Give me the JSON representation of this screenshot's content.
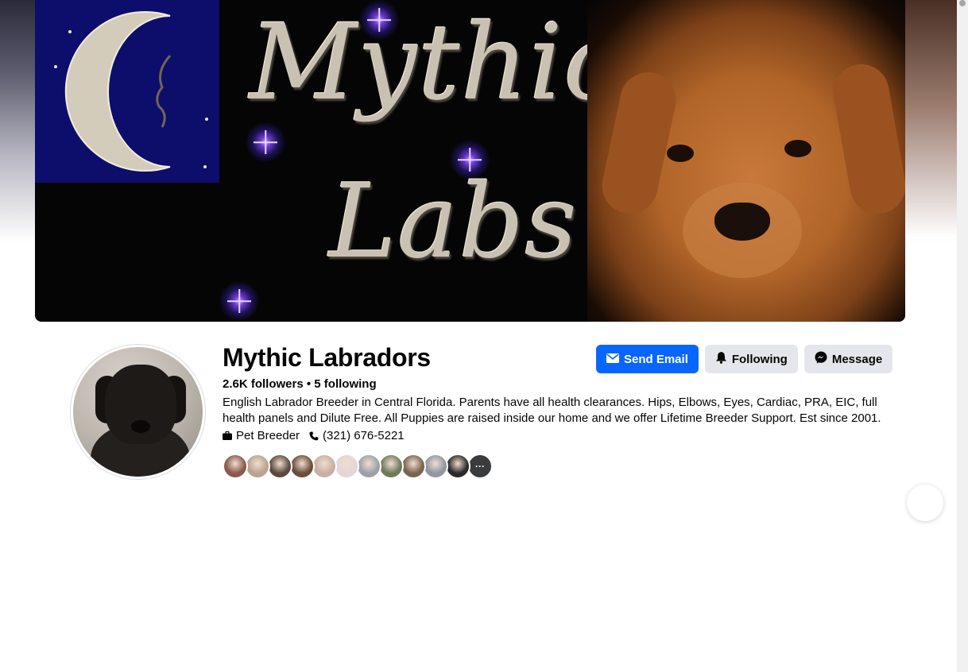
{
  "cover": {
    "word_1": "Mythic",
    "word_2": "Labs"
  },
  "page": {
    "name": "Mythic Labradors",
    "stats": "2.6K followers • 5 following",
    "bio": "English Labrador Breeder in Central Florida. Parents have all health clearances. Hips, Elbows, Eyes, Cardiac, PRA, EIC, full health panels and Dilute Free. All Puppies are raised inside our home and we offer Lifetime Breeder Support. Est since 2001.",
    "category": "Pet Breeder",
    "category_icon": "briefcase-icon",
    "phone": "(321) 676-5221",
    "phone_icon": "phone-icon"
  },
  "actions": {
    "send_email": "Send Email",
    "send_email_icon": "envelope-icon",
    "following": "Following",
    "following_icon": "bell-icon",
    "message": "Message",
    "message_icon": "messenger-icon"
  },
  "followers_preview": {
    "avatar_colors": [
      "#8a5a4e",
      "#b8a48f",
      "#5c4a3e",
      "#6b4f3a",
      "#c7b0a3",
      "#e3d6d9",
      "#9aa2a8",
      "#6e7a5a",
      "#7a6450",
      "#8f97a3",
      "#2a2a2a"
    ],
    "more_label": "···"
  },
  "colors": {
    "accent": "#0866ff",
    "secondary_button": "#e4e6eb"
  }
}
